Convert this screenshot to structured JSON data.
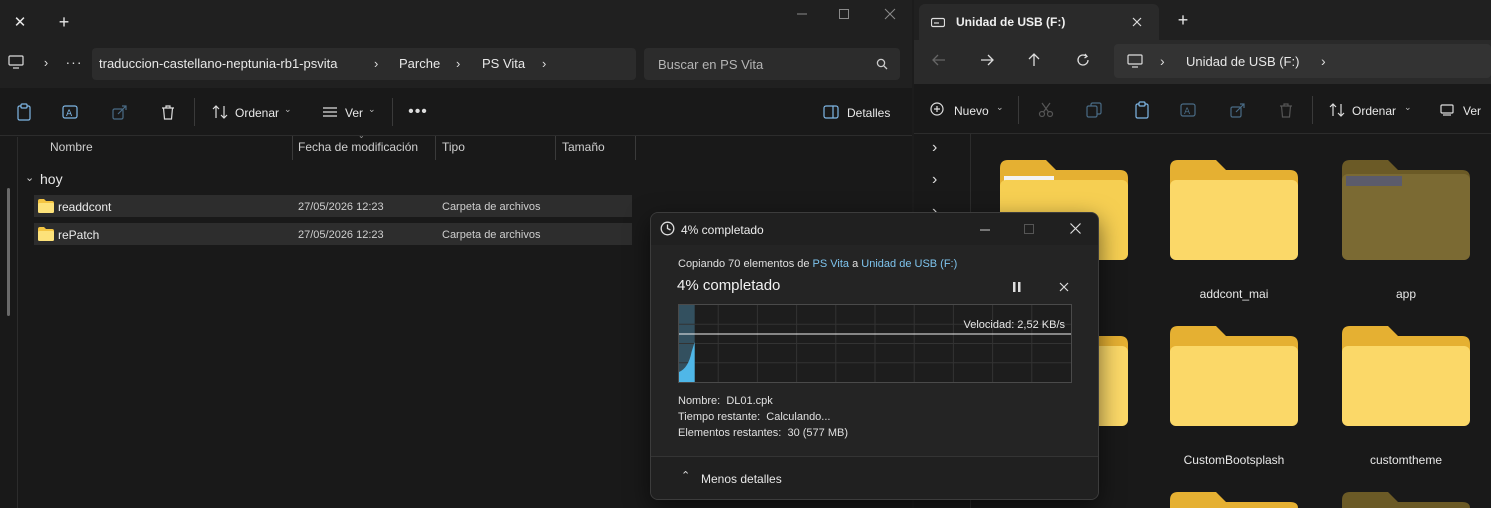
{
  "left_window": {
    "tabs_close": "✕",
    "new_tab": "+",
    "breadcrumb": [
      "traduccion-castellano-neptunia-rb1-psvita",
      "Parche",
      "PS Vita"
    ],
    "search_placeholder": "Buscar en PS Vita",
    "toolbar": {
      "sort": "Ordenar",
      "view": "Ver",
      "details": "Detalles"
    },
    "columns": [
      "Nombre",
      "Fecha de modificación",
      "Tipo",
      "Tamaño"
    ],
    "group": "hoy",
    "files": [
      {
        "name": "readdcont",
        "date": "27/05/2026 12:23",
        "type": "Carpeta de archivos"
      },
      {
        "name": "rePatch",
        "date": "27/05/2026 12:23",
        "type": "Carpeta de archivos"
      }
    ]
  },
  "right_window": {
    "tab_title": "Unidad de USB (F:)",
    "address": "Unidad de USB (F:)",
    "toolbar": {
      "new": "Nuevo",
      "sort": "Ordenar",
      "view": "Ver"
    },
    "folders": [
      {
        "name": ""
      },
      {
        "name": "addcont_mai"
      },
      {
        "name": "app"
      },
      {
        "name": ""
      },
      {
        "name": "CustomBootsplash"
      },
      {
        "name": "customtheme"
      }
    ]
  },
  "copy_dialog": {
    "title": "4% completado",
    "copy_prefix": "Copiando 70 elementos de",
    "source": "PS Vita",
    "copy_middle": "a",
    "destination": "Unidad de USB (F:)",
    "progress_text": "4% completado",
    "progress_percent": 4,
    "speed": "Velocidad: 2,52 KB/s",
    "name_label": "Nombre:",
    "name_value": "DL01.cpk",
    "time_label": "Tiempo restante:",
    "time_value": "Calculando...",
    "items_label": "Elementos restantes:",
    "items_value": "30 (577 MB)",
    "less_details": "Menos detalles"
  },
  "colors": {
    "folder": "#f4c542",
    "folder_light": "#fde27a",
    "accent_link": "#7ec4ee",
    "graph_fill": "#4fb7e8"
  }
}
